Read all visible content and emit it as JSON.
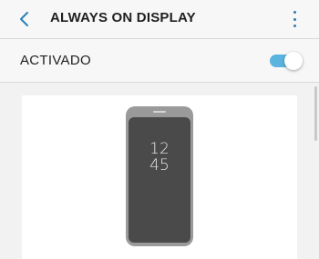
{
  "header": {
    "title": "ALWAYS ON DISPLAY",
    "back_icon": "chevron-left-icon",
    "menu_icon": "more-vertical-icon"
  },
  "toggle": {
    "label": "ACTIVADO",
    "state": "on",
    "accent_color": "#5bb3e0"
  },
  "preview": {
    "clock_hour": "12",
    "clock_minute": "45"
  },
  "colors": {
    "accent": "#2a7fb8",
    "background": "#f2f2f2",
    "phone_body": "#9a9a9a",
    "phone_screen": "#4a4a4a"
  }
}
